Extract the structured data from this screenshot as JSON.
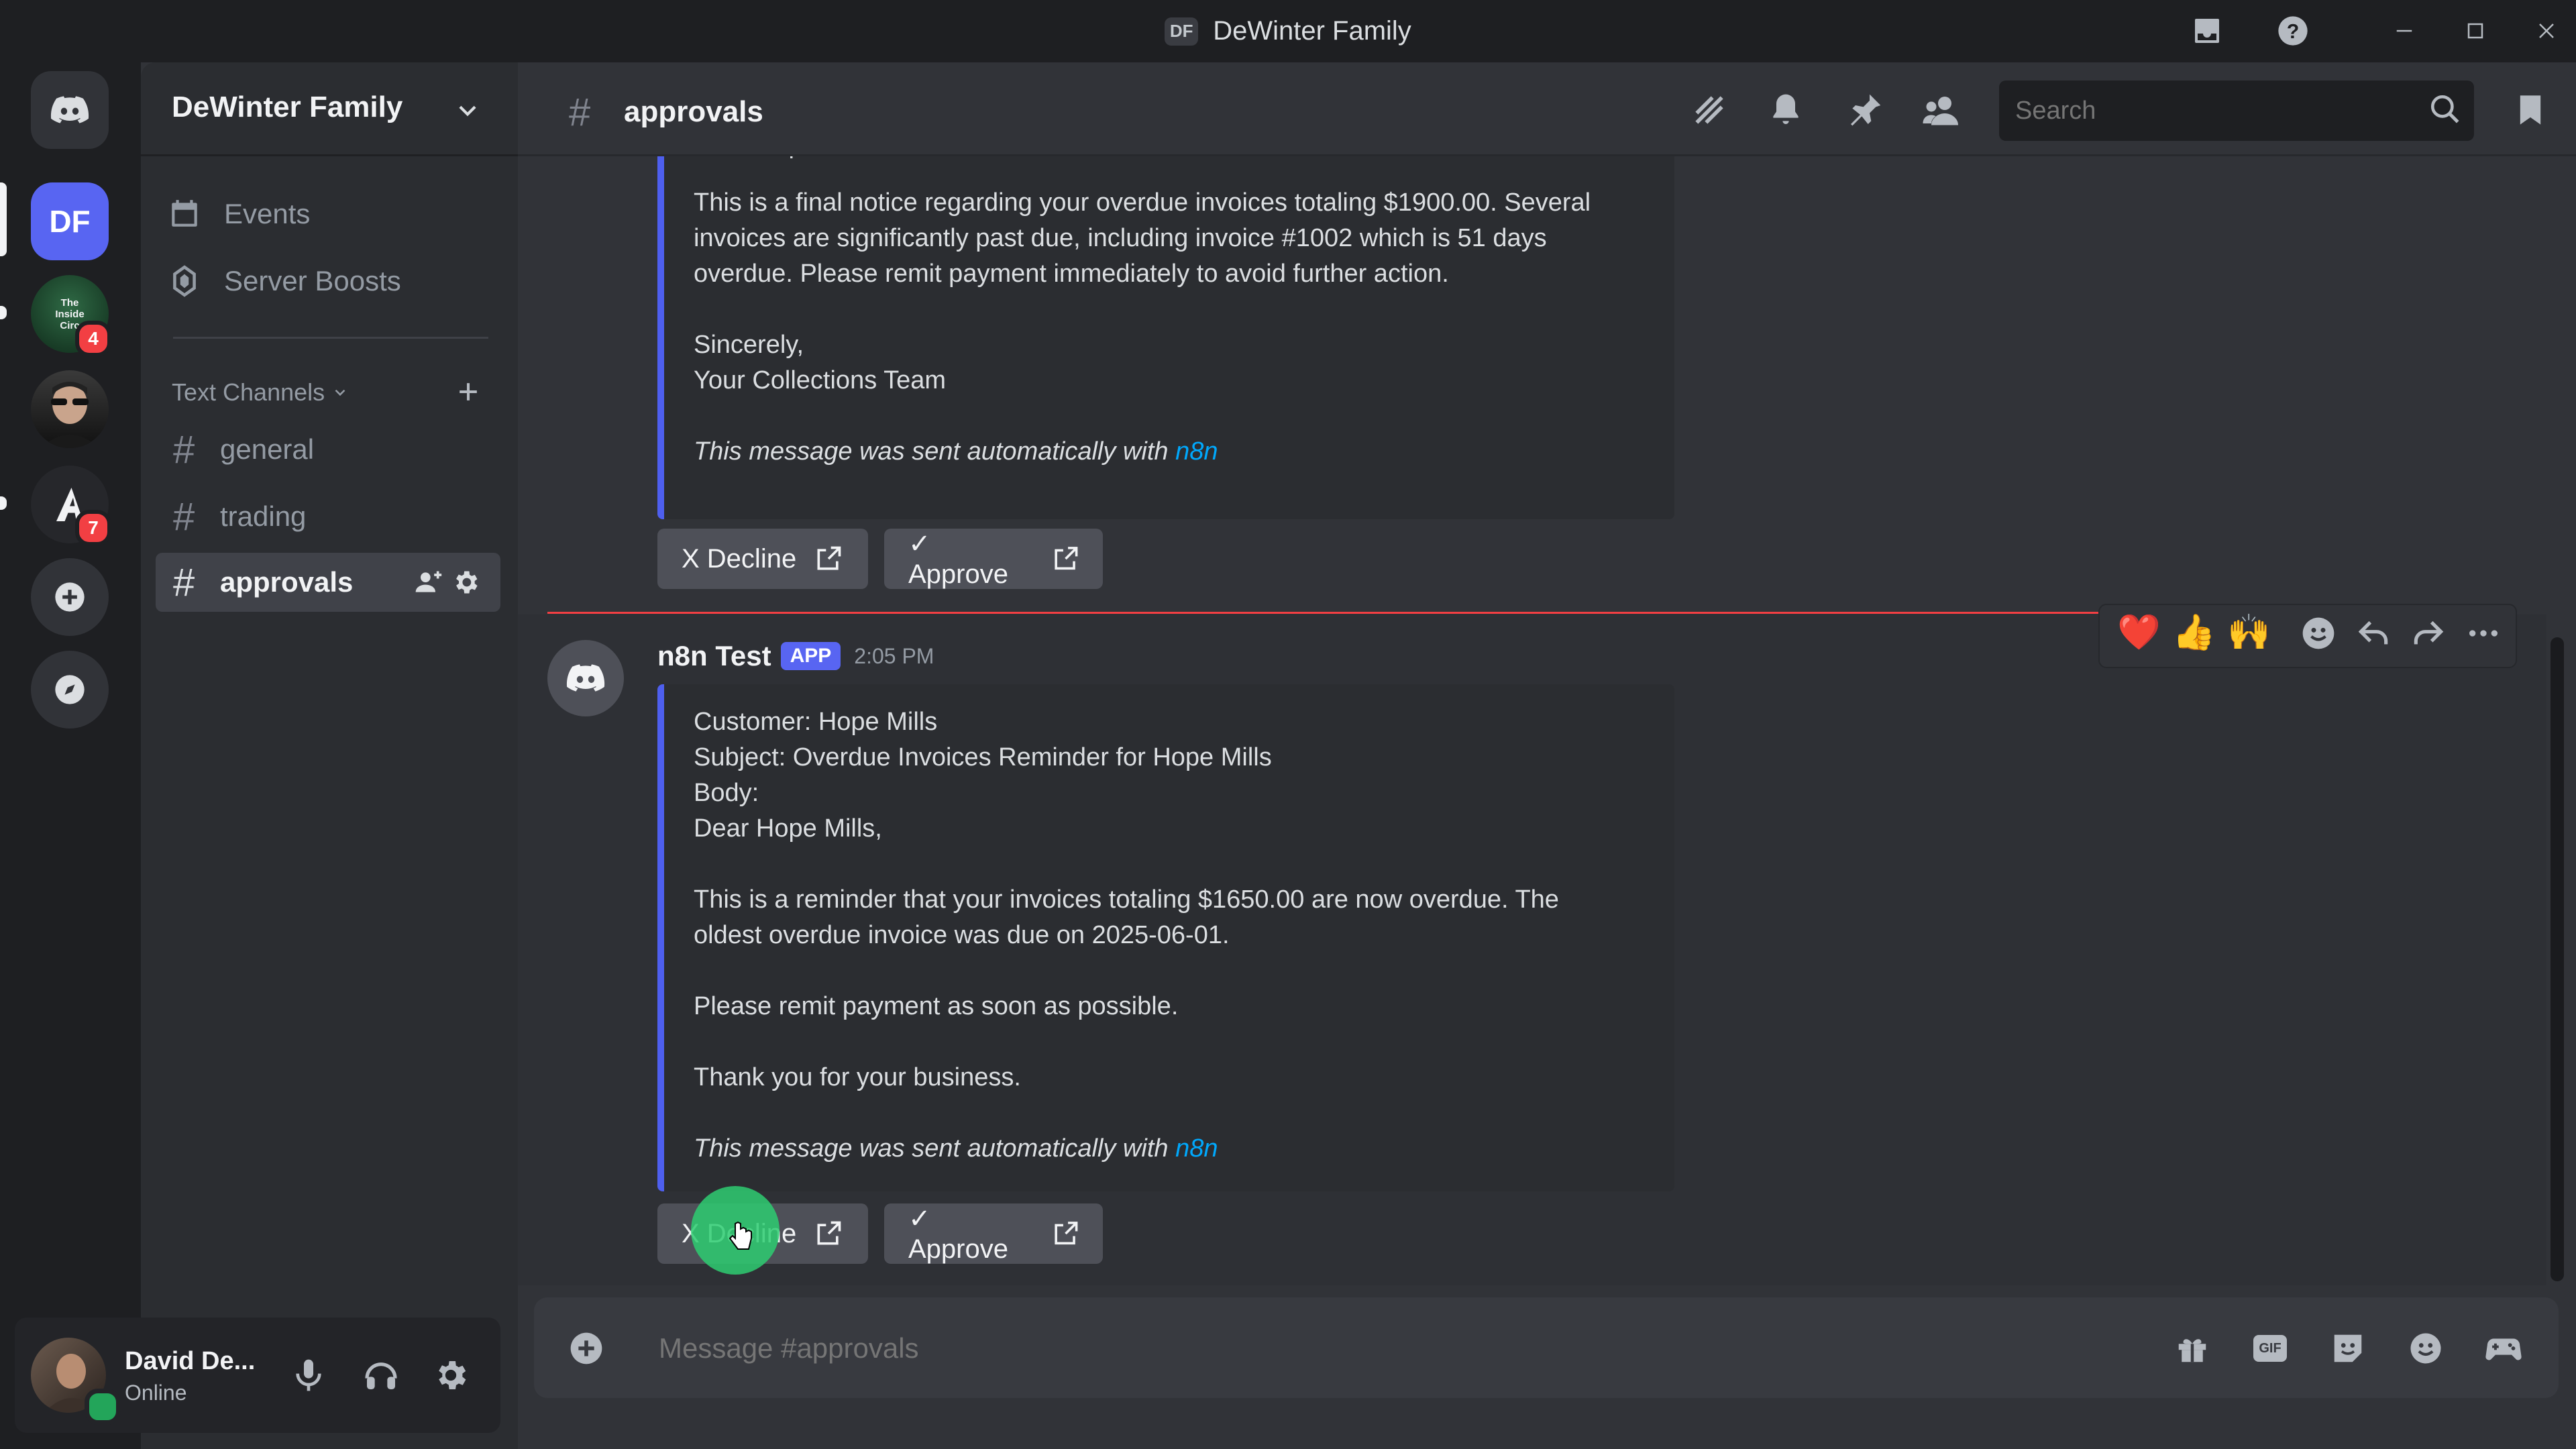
{
  "window": {
    "title": "DeWinter Family",
    "title_chip": "DF",
    "controls": [
      "minimize",
      "maximize",
      "close"
    ]
  },
  "servers": [
    {
      "label": "DF",
      "selected": true
    },
    {
      "label": "The Inside Circle",
      "badge": "4",
      "abbr": "The Inside Circ"
    },
    {
      "label": "profile-server"
    },
    {
      "label": "alpha-server",
      "badge": "7"
    }
  ],
  "sidebar": {
    "server_name": "DeWinter Family",
    "events_label": "Events",
    "boosts_label": "Server Boosts",
    "category_label": "Text Channels",
    "channels": [
      {
        "name": "general"
      },
      {
        "name": "trading"
      },
      {
        "name": "approvals",
        "active": true
      }
    ]
  },
  "user": {
    "name": "David De...",
    "status": "Online"
  },
  "header": {
    "channel_name": "approvals",
    "search_placeholder": "Search"
  },
  "messages": {
    "first_embed": {
      "partial_top": "Dear Hope Mills,",
      "paragraph": [
        "This is a final notice regarding your overdue invoices totaling $1900.00. Several",
        "invoices are significantly past due, including invoice #1002 which is 51 days",
        "overdue. Please remit payment immediately to avoid further action."
      ],
      "signoff": "Sincerely,",
      "team": "Your Collections Team",
      "footer_text": "This message was sent automatically with ",
      "footer_link": "n8n"
    },
    "second": {
      "author": "n8n Test",
      "tag": "APP",
      "time": "2:05 PM",
      "lines": {
        "customer": "Customer: Hope Mills",
        "subject": "Subject: Overdue Invoices Reminder for Hope Mills",
        "body": "Body:",
        "greeting": "Dear Hope Mills,",
        "p1a": "This is a reminder that your invoices totaling $1650.00 are now overdue. The",
        "p1b": "oldest overdue invoice was due on 2025-06-01.",
        "p2": "Please remit payment as soon as possible.",
        "p3": "Thank you for your business."
      },
      "footer_text": "This message was sent automatically with ",
      "footer_link": "n8n"
    },
    "buttons": {
      "decline": "X Decline",
      "approve": "✓ Approve"
    },
    "reactions": [
      "❤️",
      "👍",
      "🙌"
    ]
  },
  "composer": {
    "placeholder": "Message #approvals",
    "gif_label": "GIF"
  },
  "colors": {
    "accent": "#5865f2",
    "embed_border": "#4e5fee",
    "link": "#00a8fc",
    "online": "#23a55a",
    "badge": "#f23f43",
    "new_divider": "#f23f43"
  }
}
